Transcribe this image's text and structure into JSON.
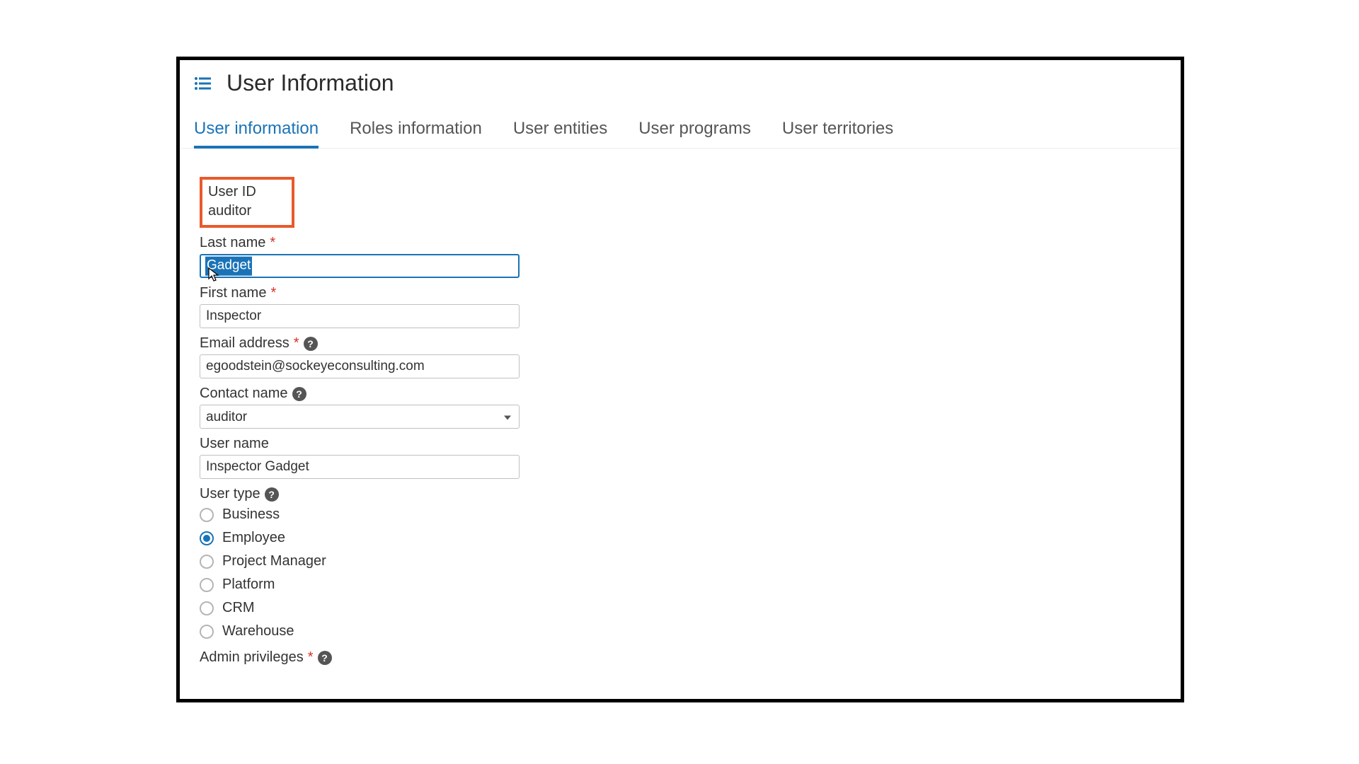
{
  "header": {
    "title": "User Information"
  },
  "tabs": [
    {
      "label": "User information",
      "active": true
    },
    {
      "label": "Roles information",
      "active": false
    },
    {
      "label": "User entities",
      "active": false
    },
    {
      "label": "User programs",
      "active": false
    },
    {
      "label": "User territories",
      "active": false
    }
  ],
  "form": {
    "user_id": {
      "label": "User ID",
      "value": "auditor"
    },
    "last_name": {
      "label": "Last name",
      "value": "Gadget",
      "required": true
    },
    "first_name": {
      "label": "First name",
      "value": "Inspector",
      "required": true
    },
    "email": {
      "label": "Email address",
      "value": "egoodstein@sockeyeconsulting.com",
      "required": true
    },
    "contact_name": {
      "label": "Contact name",
      "value": "auditor"
    },
    "user_name": {
      "label": "User name",
      "value": "Inspector Gadget"
    },
    "user_type": {
      "label": "User type",
      "options": [
        "Business",
        "Employee",
        "Project Manager",
        "Platform",
        "CRM",
        "Warehouse"
      ],
      "selected": "Employee"
    },
    "admin_privileges": {
      "label": "Admin privileges",
      "required": true
    }
  }
}
